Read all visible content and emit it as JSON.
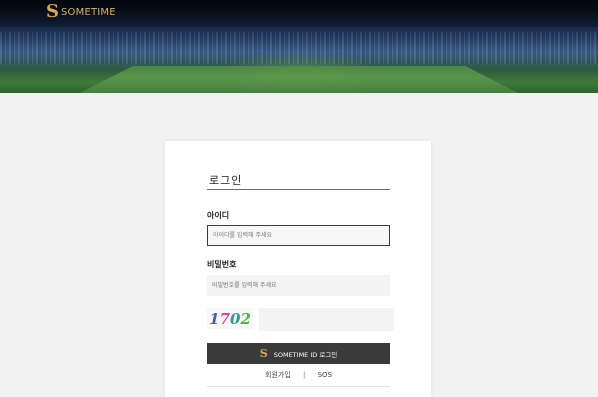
{
  "header": {
    "logo_mark": "S",
    "logo_text": "SOMETIME"
  },
  "login": {
    "title": "로그인",
    "id_label": "아이디",
    "id_placeholder": "아이디를 입력해 주세요",
    "password_label": "비밀번호",
    "password_placeholder": "비밀번호를 입력해 주세요",
    "captcha_chars": [
      "1",
      "7",
      "0",
      "2"
    ],
    "submit_label": "SOMETIME ID 로그인",
    "signup_link": "회원가입",
    "separator": "|",
    "sos_link": "SOS"
  },
  "colors": {
    "brand_gold": "#d4a958",
    "button_dark": "#3a3a3a"
  }
}
